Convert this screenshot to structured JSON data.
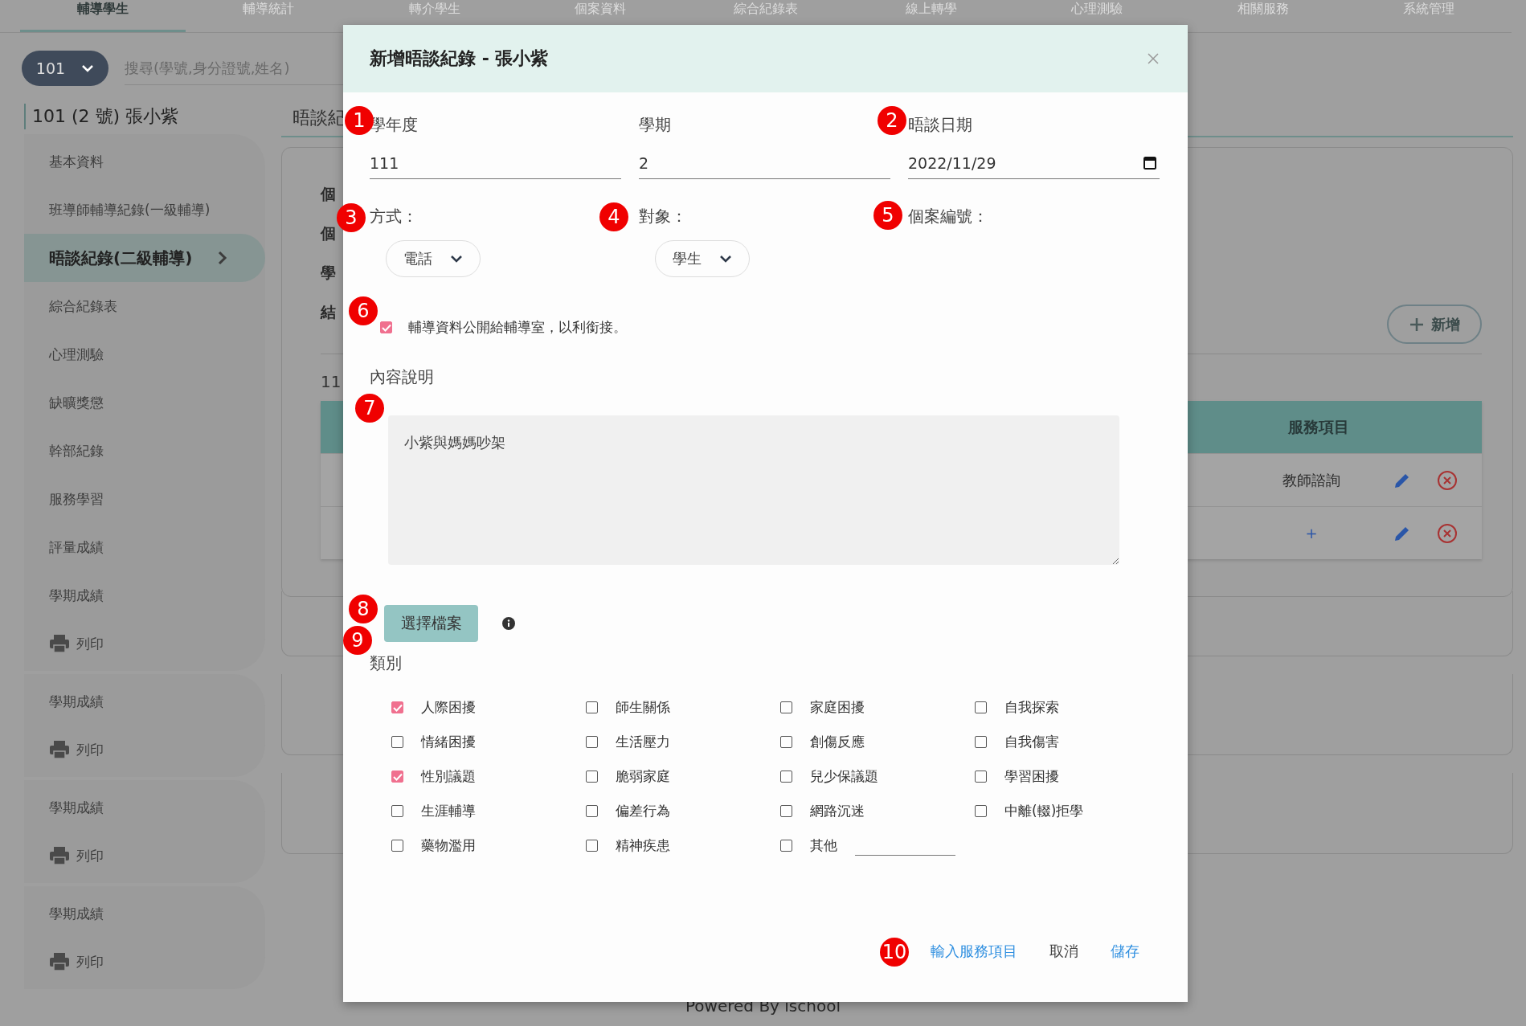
{
  "nav_tabs": [
    {
      "label": "輔導學生",
      "selected": true
    },
    {
      "label": "輔導統計",
      "selected": false
    },
    {
      "label": "轉介學生",
      "selected": false
    },
    {
      "label": "個案資料",
      "selected": false
    },
    {
      "label": "綜合紀錄表",
      "selected": false
    },
    {
      "label": "線上轉學",
      "selected": false
    },
    {
      "label": "心理測驗",
      "selected": false
    },
    {
      "label": "相關服務",
      "selected": false
    },
    {
      "label": "系統管理",
      "selected": false
    }
  ],
  "class_select": {
    "value": "101"
  },
  "search": {
    "placeholder": "搜尋(學號,身分證號,姓名)"
  },
  "student_heading": "101 (2 號) 張小紫",
  "sidebar": {
    "groups": [
      {
        "items": [
          {
            "label": "基本資料",
            "kind": "text",
            "selected": false
          },
          {
            "label": "班導師輔導紀錄(一級輔導)",
            "kind": "text",
            "selected": false
          },
          {
            "label": "晤談紀錄(二級輔導)",
            "kind": "text",
            "selected": true
          },
          {
            "label": "綜合紀錄表",
            "kind": "text",
            "selected": false
          },
          {
            "label": "心理測驗",
            "kind": "text",
            "selected": false
          },
          {
            "label": "缺曠獎懲",
            "kind": "text",
            "selected": false
          },
          {
            "label": "幹部紀錄",
            "kind": "text",
            "selected": false
          },
          {
            "label": "服務學習",
            "kind": "text",
            "selected": false
          },
          {
            "label": "評量成績",
            "kind": "text",
            "selected": false
          },
          {
            "label": "學期成績",
            "kind": "text",
            "selected": false
          },
          {
            "label": "列印",
            "kind": "print",
            "selected": false
          }
        ]
      },
      {
        "items": [
          {
            "label": "學期成績",
            "kind": "text",
            "selected": false
          },
          {
            "label": "列印",
            "kind": "print",
            "selected": false
          }
        ]
      },
      {
        "items": [
          {
            "label": "學期成績",
            "kind": "text",
            "selected": false
          },
          {
            "label": "列印",
            "kind": "print",
            "selected": false
          }
        ]
      },
      {
        "items": [
          {
            "label": "學期成績",
            "kind": "text",
            "selected": false
          },
          {
            "label": "列印",
            "kind": "print",
            "selected": false
          }
        ]
      }
    ]
  },
  "main": {
    "tab_label": "晤談紀",
    "card_labels": [
      "個",
      "個",
      "學",
      "結"
    ],
    "add_button": "新增",
    "section_title": "11",
    "table": {
      "columns": [
        "服務項目"
      ],
      "rows": [
        {
          "service": "教師諮詢"
        },
        {
          "service": "+"
        }
      ]
    }
  },
  "footer": "Powered By ischool",
  "modal": {
    "title": "新增晤談紀錄 - 張小紫",
    "fields": [
      {
        "label": "學年度",
        "value": "111",
        "kind": "text"
      },
      {
        "label": "學期",
        "value": "2",
        "kind": "text"
      },
      {
        "label": "晤談日期",
        "value": "2022/11/29",
        "kind": "date"
      }
    ],
    "selects": [
      {
        "label": "方式：",
        "value": "電話",
        "kind": "select"
      },
      {
        "label": "對象：",
        "value": "學生",
        "kind": "select"
      },
      {
        "label": "個案編號：",
        "kind": "label"
      }
    ],
    "share_checkbox": {
      "label": "輔導資料公開給輔導室，以利銜接。",
      "checked": true
    },
    "content": {
      "label": "內容說明",
      "value": "小紫與媽媽吵架"
    },
    "file_button": "選擇檔案",
    "category": {
      "label": "類別",
      "options": [
        {
          "label": "人際困擾",
          "checked": true,
          "kind": "option"
        },
        {
          "label": "師生關係",
          "checked": false,
          "kind": "option"
        },
        {
          "label": "家庭困擾",
          "checked": false,
          "kind": "option"
        },
        {
          "label": "自我探索",
          "checked": false,
          "kind": "option"
        },
        {
          "label": "情緒困擾",
          "checked": false,
          "kind": "option"
        },
        {
          "label": "生活壓力",
          "checked": false,
          "kind": "option"
        },
        {
          "label": "創傷反應",
          "checked": false,
          "kind": "option"
        },
        {
          "label": "自我傷害",
          "checked": false,
          "kind": "option"
        },
        {
          "label": "性別議題",
          "checked": true,
          "kind": "option"
        },
        {
          "label": "脆弱家庭",
          "checked": false,
          "kind": "option"
        },
        {
          "label": "兒少保議題",
          "checked": false,
          "kind": "option"
        },
        {
          "label": "學習困擾",
          "checked": false,
          "kind": "option"
        },
        {
          "label": "生涯輔導",
          "checked": false,
          "kind": "option"
        },
        {
          "label": "偏差行為",
          "checked": false,
          "kind": "option"
        },
        {
          "label": "網路沉迷",
          "checked": false,
          "kind": "option"
        },
        {
          "label": "中離(輟)拒學",
          "checked": false,
          "kind": "option"
        },
        {
          "label": "藥物濫用",
          "checked": false,
          "kind": "option"
        },
        {
          "label": "精神疾患",
          "checked": false,
          "kind": "option"
        },
        {
          "label": "其他",
          "checked": false,
          "kind": "other"
        }
      ]
    },
    "actions": [
      {
        "label": "輸入服務項目",
        "kind": "primary"
      },
      {
        "label": "取消",
        "kind": "plain"
      },
      {
        "label": "儲存",
        "kind": "primary"
      }
    ],
    "markers": [
      "1",
      "2",
      "3",
      "4",
      "5",
      "6",
      "7",
      "8",
      "9",
      "10"
    ]
  }
}
